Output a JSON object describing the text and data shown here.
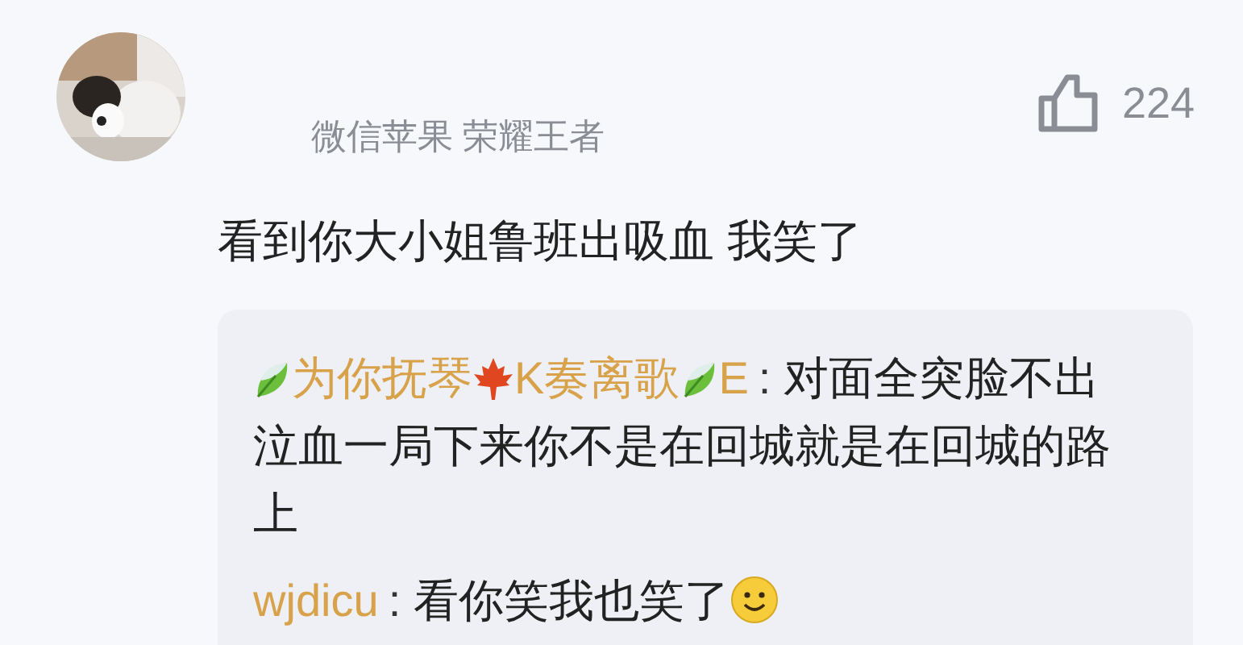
{
  "author": {
    "name": "微信苹果 荣耀王者"
  },
  "likes": {
    "count": "224"
  },
  "text": "看到你大小姐鲁班出吸血 我笑了",
  "replies": [
    {
      "author_parts": [
        {
          "kind": "leaf"
        },
        {
          "kind": "text",
          "text": "为你抚琴"
        },
        {
          "kind": "maple"
        },
        {
          "kind": "text",
          "text": "K奏离歌"
        },
        {
          "kind": "leaf"
        },
        {
          "kind": "text",
          "text": "E"
        }
      ],
      "separator": ":",
      "text": "对面全突脸不出泣血一局下来你不是在回城就是在回城的路上"
    },
    {
      "author_parts": [
        {
          "kind": "text",
          "text": "wjdicu"
        }
      ],
      "separator": ":",
      "text": "看你笑我也笑了",
      "trailing_icon": {
        "kind": "smile"
      }
    }
  ]
}
